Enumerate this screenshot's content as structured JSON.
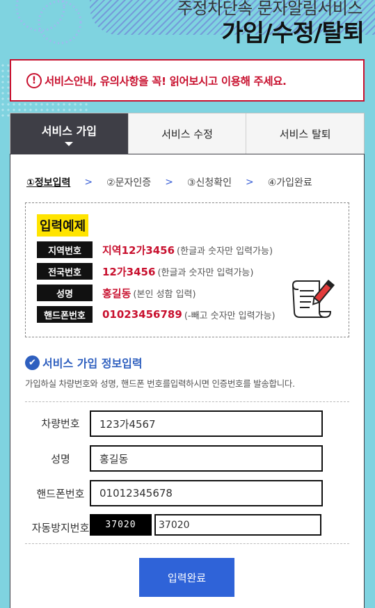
{
  "header": {
    "subtitle": "주정차단속 문자알림서비스",
    "title": "가입/수정/탈퇴"
  },
  "notice": {
    "icon": "exclamation-circle-icon",
    "text": "서비스안내, 유의사항을 꼭! 읽어보시고 이용해 주세요."
  },
  "tabs": [
    {
      "label": "서비스 가입",
      "active": true
    },
    {
      "label": "서비스 수정",
      "active": false
    },
    {
      "label": "서비스 탈퇴",
      "active": false
    }
  ],
  "steps": [
    {
      "label": "①정보입력",
      "current": true
    },
    {
      "label": "②문자인증",
      "current": false
    },
    {
      "label": "③신청확인",
      "current": false
    },
    {
      "label": "④가입완료",
      "current": false
    }
  ],
  "example": {
    "title": "입력예제",
    "rows": [
      {
        "label": "지역번호",
        "value": "지역12가3456",
        "note": "(한글과 숫자만 입력가능)"
      },
      {
        "label": "전국번호",
        "value": "12가3456",
        "note": "(한글과 숫자만 입력가능)"
      },
      {
        "label": "성명",
        "value": "홍길동",
        "note": "(본인 성함 입력)"
      },
      {
        "label": "핸드폰번호",
        "value": "01023456789",
        "note": "(-빼고 숫자만 입력가능)"
      }
    ]
  },
  "section": {
    "title": "서비스 가입 정보입력",
    "desc": "가입하실 차량번호와 성명, 핸드폰 번호를입력하시면 인증번호를 발송합니다."
  },
  "form": {
    "car_label": "차량번호",
    "car_value": "123가4567",
    "name_label": "성명",
    "name_value": "홍길동",
    "phone_label": "핸드폰번호",
    "phone_value": "01012345678",
    "captcha_label": "자동방지번호",
    "captcha_code": "37020",
    "captcha_value": "37020"
  },
  "submit_label": "입력완료",
  "colors": {
    "accent": "#2f63d8",
    "alert": "#c8102e",
    "tab_active": "#3e3e46",
    "background": "#7fd3e0"
  }
}
